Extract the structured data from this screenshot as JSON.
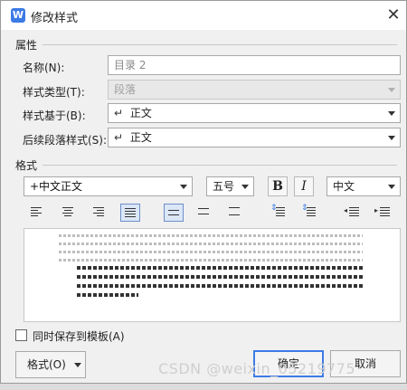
{
  "dialog": {
    "title": "修改样式",
    "close_glyph": "✕",
    "app_icon_letter": "W"
  },
  "properties": {
    "section": "属性",
    "name_label": "名称(N):",
    "name_value": "目录 2",
    "type_label": "样式类型(T):",
    "type_value": "段落",
    "based_label": "样式基于(B):",
    "based_value": "正文",
    "next_label": "后续段落样式(S):",
    "next_value": "正文",
    "para_glyph": "↵"
  },
  "format": {
    "section": "格式",
    "font": "+中文正文",
    "size": "五号",
    "bold": "B",
    "italic": "I",
    "script": "中文"
  },
  "footer": {
    "save_label": "同时保存到模板(A)",
    "format_button": "格式(O)",
    "ok": "确定",
    "cancel": "取消"
  },
  "watermark": "CSDN @weixin_05219775"
}
